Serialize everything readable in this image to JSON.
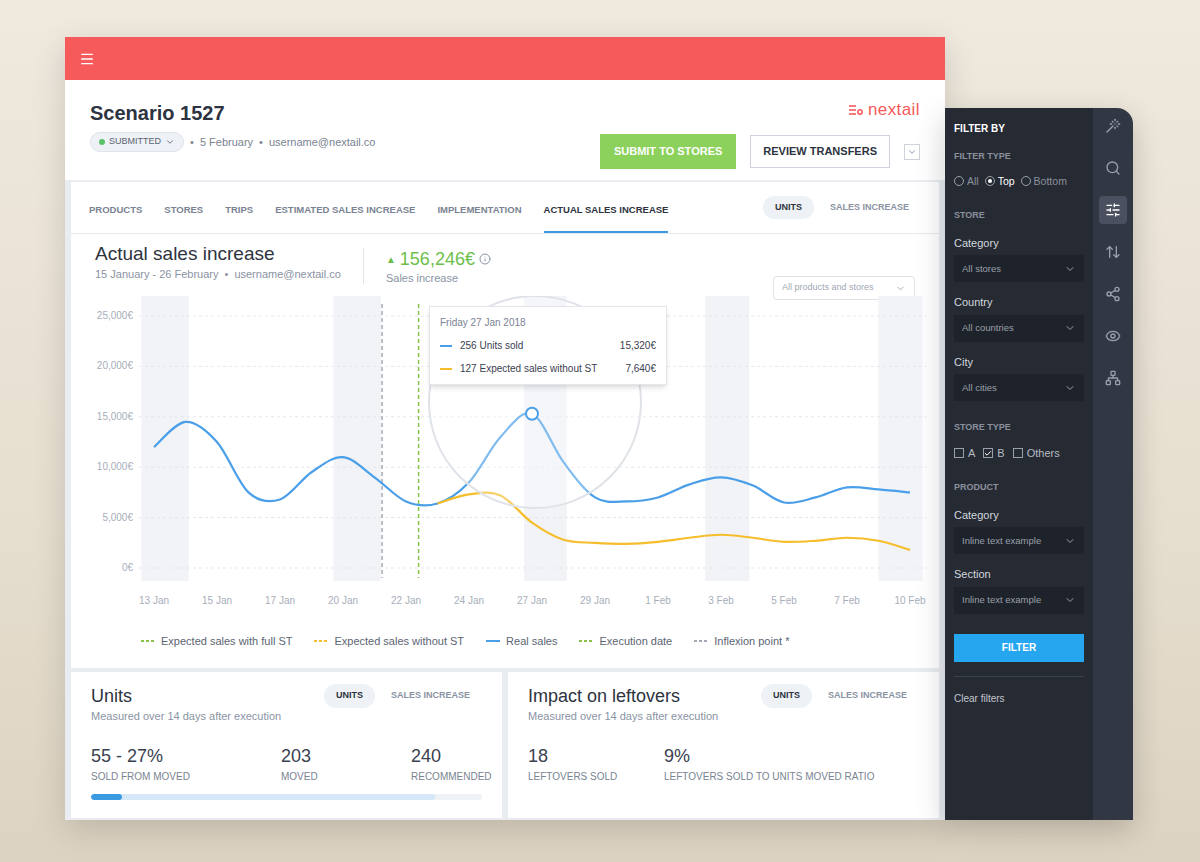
{
  "header": {
    "logo": "nextail"
  },
  "scenario": {
    "title": "Scenario 1527",
    "status": "SUBMITTED",
    "separator": "•",
    "date": "5 February",
    "user": "username@nextail.co"
  },
  "actions": {
    "submit": "SUBMIT TO STORES",
    "review": "REVIEW TRANSFERS"
  },
  "tabs": [
    {
      "label": "PRODUCTS",
      "selected": false
    },
    {
      "label": "STORES",
      "selected": false
    },
    {
      "label": "TRIPS",
      "selected": false
    },
    {
      "label": "ESTIMATED SALES INCREASE",
      "selected": false
    },
    {
      "label": "IMPLEMENTATION",
      "selected": false
    },
    {
      "label": "ACTUAL SALES INCREASE",
      "selected": true
    }
  ],
  "chart_toggle": [
    {
      "label": "UNITS",
      "selected": true
    },
    {
      "label": "SALES INCREASE",
      "selected": false
    }
  ],
  "chart_card": {
    "title": "Actual sales increase",
    "period": "15 January - 26 February",
    "separator": "•",
    "user": "username@nextail.co",
    "delta_arrow": "▲",
    "delta": "156,246€",
    "delta_label": "Sales increase",
    "scope": "All products and stores"
  },
  "chart": {
    "y_ticks": [
      {
        "label": "25,000€",
        "value": 25000
      },
      {
        "label": "20,000€",
        "value": 20000
      },
      {
        "label": "15,000€",
        "value": 15000
      },
      {
        "label": "10,000€",
        "value": 10000
      },
      {
        "label": "5,000€",
        "value": 5000
      },
      {
        "label": "0€",
        "value": 0
      }
    ],
    "x_ticks": [
      {
        "label": "13 Jan",
        "index": 0
      },
      {
        "label": "15 Jan",
        "index": 2
      },
      {
        "label": "17 Jan",
        "index": 4
      },
      {
        "label": "20 Jan",
        "index": 6
      },
      {
        "label": "22 Jan",
        "index": 8
      },
      {
        "label": "24 Jan",
        "index": 10
      },
      {
        "label": "27 Jan",
        "index": 12
      },
      {
        "label": "29 Jan",
        "index": 14
      },
      {
        "label": "1 Feb",
        "index": 16
      },
      {
        "label": "3 Feb",
        "index": 18
      },
      {
        "label": "5 Feb",
        "index": 20
      },
      {
        "label": "7 Feb",
        "index": 22
      },
      {
        "label": "10 Feb",
        "index": 24
      }
    ],
    "shaded": [
      [
        -0.4,
        1.1
      ],
      [
        5.7,
        7.2
      ],
      [
        11.75,
        13.1
      ],
      [
        17.5,
        18.9
      ],
      [
        23.0,
        24.4
      ]
    ],
    "series": [
      {
        "name": "Real sales",
        "color": "#4a9fe8",
        "start_index": 0,
        "values": [
          12000,
          14500,
          12500,
          7500,
          6800,
          9500,
          11000,
          9000,
          6600,
          6400,
          8500,
          13000,
          15300,
          10500,
          7000,
          6600,
          7000,
          8300,
          9000,
          8200,
          6500,
          7000,
          8000,
          7800,
          7500
        ]
      },
      {
        "name": "Expected sales without ST",
        "color": "#f6bd2c",
        "start_index": 9,
        "values": [
          6400,
          7300,
          7200,
          4500,
          2800,
          2500,
          2400,
          2600,
          3000,
          3300,
          3000,
          2600,
          2700,
          3000,
          2700,
          1800
        ]
      }
    ],
    "markers": [
      {
        "name": "Inflexion point",
        "index": 7.24,
        "color": "#a3a9b4"
      },
      {
        "name": "Execution date",
        "index": 8.4,
        "color": "#8bc34a"
      }
    ],
    "tooltip": {
      "index": 12,
      "date": "Friday 27 Jan 2018",
      "rows": [
        {
          "label": "256 Units sold",
          "value": "15,320€",
          "color": "#4a9fe8"
        },
        {
          "label": "127 Expected sales without ST",
          "value": "7,640€",
          "color": "#f6bd2c"
        }
      ]
    },
    "legend": [
      {
        "label": "Expected sales with full ST",
        "color": "#8bc34a",
        "kind": "dashed"
      },
      {
        "label": "Expected sales without ST",
        "color": "#f6bd2c",
        "kind": "dashed"
      },
      {
        "label": "Real sales",
        "color": "#4a9fe8",
        "kind": "solid"
      },
      {
        "label": "Execution date",
        "color": "#8bc34a",
        "kind": "dashed"
      },
      {
        "label": "Inflexion point *",
        "color": "#a3a9b4",
        "kind": "dashed"
      }
    ]
  },
  "units_card": {
    "title": "Units",
    "subtitle": "Measured over 14 days after execution",
    "toggle": [
      {
        "label": "UNITS",
        "selected": true
      },
      {
        "label": "SALES INCREASE",
        "selected": false
      }
    ],
    "stats": [
      {
        "value": "55 - 27%",
        "label": "SOLD FROM MOVED"
      },
      {
        "value": "203",
        "label": "MOVED"
      },
      {
        "value": "240",
        "label": "RECOMMENDED"
      }
    ],
    "progress": {
      "level": 0.08,
      "secondary_level": 0.88
    }
  },
  "leftovers_card": {
    "title": "Impact on leftovers",
    "subtitle": "Measured over 14 days after execution",
    "toggle": [
      {
        "label": "UNITS",
        "selected": true
      },
      {
        "label": "SALES INCREASE",
        "selected": false
      }
    ],
    "stats": [
      {
        "value": "18",
        "label": "LEFTOVERS SOLD"
      },
      {
        "value": "9%",
        "label": "LEFTOVERS SOLD TO UNITS MOVED RATIO"
      }
    ]
  },
  "filters": {
    "title": "FILTER BY",
    "filter_type": {
      "label": "FILTER TYPE",
      "options": [
        {
          "label": "All",
          "selected": false
        },
        {
          "label": "Top",
          "selected": true
        },
        {
          "label": "Bottom",
          "selected": false
        }
      ]
    },
    "store": {
      "label": "STORE",
      "fields": [
        {
          "label": "Category",
          "value": "All stores"
        },
        {
          "label": "Country",
          "value": "All countries"
        },
        {
          "label": "City",
          "value": "All cities"
        }
      ]
    },
    "store_type": {
      "label": "STORE TYPE",
      "options": [
        {
          "label": "A",
          "checked": false
        },
        {
          "label": "B",
          "checked": true
        },
        {
          "label": "Others",
          "checked": false
        }
      ]
    },
    "product": {
      "label": "PRODUCT",
      "fields": [
        {
          "label": "Category",
          "value": "Inline text example"
        },
        {
          "label": "Section",
          "value": "Inline text example"
        }
      ]
    },
    "button": "FILTER",
    "clear": "Clear filters"
  },
  "rail": [
    {
      "selected": false
    },
    {
      "selected": false
    },
    {
      "selected": true
    },
    {
      "selected": false
    },
    {
      "selected": false
    },
    {
      "selected": false
    },
    {
      "selected": false
    }
  ]
}
